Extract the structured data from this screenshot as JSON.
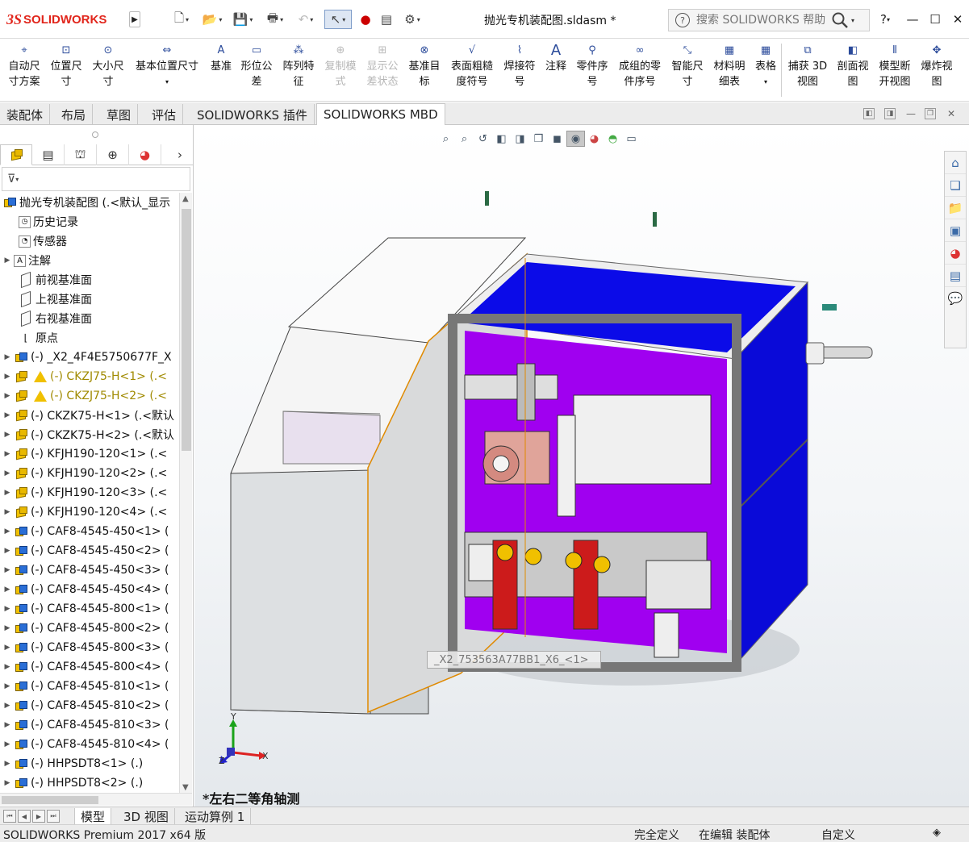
{
  "app": {
    "logo_ds": "3S",
    "logo_name": "SOLIDWORKS",
    "doc_title": "抛光专机装配图.sldasm *"
  },
  "search": {
    "placeholder": "搜索 SOLIDWORKS 帮助"
  },
  "window": {
    "help": "?",
    "minimize": "—",
    "maximize": "☐",
    "close": "✕"
  },
  "commands": [
    {
      "l1": "自动尺",
      "l2": "寸方案"
    },
    {
      "l1": "位置尺",
      "l2": "寸"
    },
    {
      "l1": "大小尺",
      "l2": "寸"
    },
    {
      "l1": "基本位置尺寸",
      "l2": ""
    },
    {
      "l1": "基准",
      "l2": ""
    },
    {
      "l1": "形位公",
      "l2": "差"
    },
    {
      "l1": "阵列特",
      "l2": "征"
    },
    {
      "l1": "复制模",
      "l2": "式"
    },
    {
      "l1": "显示公",
      "l2": "差状态"
    },
    {
      "l1": "基准目",
      "l2": "标"
    },
    {
      "l1": "表面粗糙",
      "l2": "度符号"
    },
    {
      "l1": "焊接符",
      "l2": "号"
    },
    {
      "l1": "注释",
      "l2": ""
    },
    {
      "l1": "零件序",
      "l2": "号"
    },
    {
      "l1": "成组的零",
      "l2": "件序号"
    },
    {
      "l1": "智能尺",
      "l2": "寸"
    },
    {
      "l1": "材料明",
      "l2": "细表"
    },
    {
      "l1": "表格",
      "l2": ""
    },
    {
      "l1": "捕获 3D",
      "l2": "视图"
    },
    {
      "l1": "剖面视",
      "l2": "图"
    },
    {
      "l1": "模型断",
      "l2": "开视图"
    },
    {
      "l1": "爆炸视",
      "l2": "图"
    }
  ],
  "tabs": [
    "装配体",
    "布局",
    "草图",
    "评估",
    "SOLIDWORKS 插件",
    "SOLIDWORKS MBD"
  ],
  "tree": {
    "root": "抛光专机装配图 (.<默认_显示",
    "items": [
      {
        "label": "历史记录"
      },
      {
        "label": "传感器"
      },
      {
        "label": "注解"
      },
      {
        "label": "前视基准面"
      },
      {
        "label": "上视基准面"
      },
      {
        "label": "右视基准面"
      },
      {
        "label": "原点"
      },
      {
        "label": "(-) _X2_4F4E5750677F_X"
      },
      {
        "label": "(-) CKZJ75-H<1> (.<"
      },
      {
        "label": "(-) CKZJ75-H<2> (.<"
      },
      {
        "label": "(-) CKZK75-H<1> (.<默认"
      },
      {
        "label": "(-) CKZK75-H<2> (.<默认"
      },
      {
        "label": "(-) KFJH190-120<1> (.<"
      },
      {
        "label": "(-) KFJH190-120<2> (.<"
      },
      {
        "label": "(-) KFJH190-120<3> (.<"
      },
      {
        "label": "(-) KFJH190-120<4> (.<"
      },
      {
        "label": "(-) CAF8-4545-450<1> ("
      },
      {
        "label": "(-) CAF8-4545-450<2> ("
      },
      {
        "label": "(-) CAF8-4545-450<3> ("
      },
      {
        "label": "(-) CAF8-4545-450<4> ("
      },
      {
        "label": "(-) CAF8-4545-800<1> ("
      },
      {
        "label": "(-) CAF8-4545-800<2> ("
      },
      {
        "label": "(-) CAF8-4545-800<3> ("
      },
      {
        "label": "(-) CAF8-4545-800<4> ("
      },
      {
        "label": "(-) CAF8-4545-810<1> ("
      },
      {
        "label": "(-) CAF8-4545-810<2> ("
      },
      {
        "label": "(-) CAF8-4545-810<3> ("
      },
      {
        "label": "(-) CAF8-4545-810<4> ("
      },
      {
        "label": "(-) HHPSDT8<1> (.)"
      },
      {
        "label": "(-) HHPSDT8<2> (.)"
      }
    ]
  },
  "viewport": {
    "view_label": "*左右二等角轴测",
    "tooltip": "_X2_753563A77BB1_X6_<1>",
    "axis_x": "X",
    "axis_y": "Y",
    "axis_z": "Z"
  },
  "bottom_tabs": [
    "模型",
    "3D 视图",
    "运动算例 1"
  ],
  "status": {
    "product": "SOLIDWORKS Premium 2017 x64 版",
    "state": "完全定义",
    "mode": "在编辑 装配体",
    "custom": "自定义"
  },
  "colors": {
    "blue_panel": "#1a1ae6",
    "purple": "#a000f0",
    "brand_red": "#e1251b"
  }
}
